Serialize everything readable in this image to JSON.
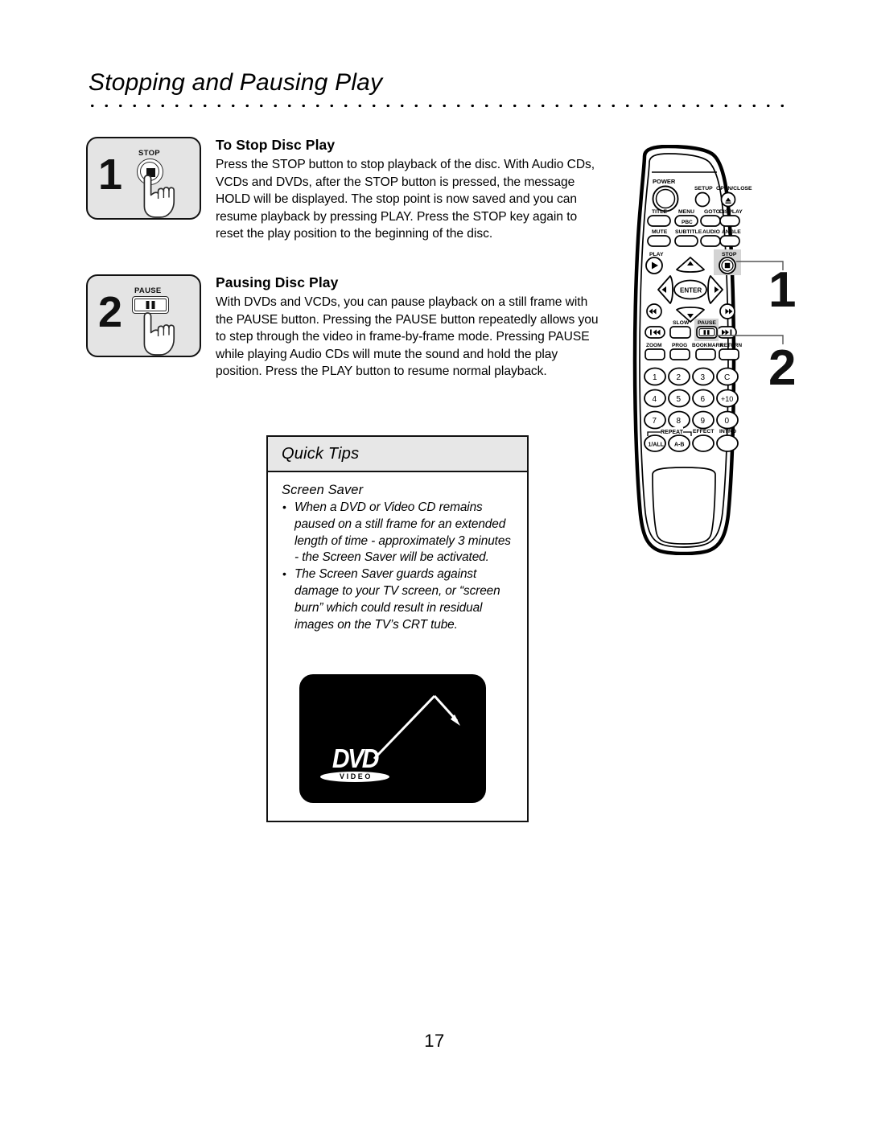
{
  "page": {
    "title": "Stopping and Pausing Play",
    "number": "17"
  },
  "sections": [
    {
      "step": "1",
      "button_label": "STOP",
      "heading": "To Stop Disc Play",
      "body": "Press the STOP button to stop playback of the disc. With Audio CDs, VCDs and DVDs, after the STOP button is pressed, the message HOLD will be displayed. The stop point is now saved and you can resume playback by pressing PLAY. Press the STOP key again to reset the play position to the beginning of the disc."
    },
    {
      "step": "2",
      "button_label": "PAUSE",
      "heading": "Pausing Disc Play",
      "body": "With DVDs and VCDs, you can pause playback on a still frame with the PAUSE button. Pressing the PAUSE button repeatedly allows you to step through the video in frame-by-frame mode. Pressing PAUSE while playing Audio CDs will mute the sound and hold the play position. Press the PLAY button to resume normal playback."
    }
  ],
  "quick_tips": {
    "header": "Quick Tips",
    "subtitle": "Screen Saver",
    "bullets": [
      "When a DVD or Video CD remains paused on a still frame for an extended length of time - approximately 3 minutes - the Screen Saver will be activated.",
      "The Screen Saver guards against damage to your TV screen, or “screen burn” which could result in residual images on the TV’s CRT tube."
    ],
    "screensaver_image": {
      "logo_top": "DVD",
      "logo_bottom": "VIDEO"
    }
  },
  "callouts": [
    {
      "number": "1",
      "points_to": "STOP"
    },
    {
      "number": "2",
      "points_to": "PAUSE"
    }
  ],
  "remote": {
    "power": "POWER",
    "row_setup": [
      "SETUP",
      "OPEN/CLOSE"
    ],
    "row_title": [
      "TITLE",
      "MENU",
      "PBC",
      "GOTO",
      "DISPLAY"
    ],
    "row_mute": [
      "MUTE",
      "SUBTITLE",
      "AUDIO",
      "ANGLE"
    ],
    "play": "PLAY",
    "stop": "STOP",
    "enter": "ENTER",
    "slow": "SLOW",
    "pause": "PAUSE",
    "row_zoom": [
      "ZOOM",
      "PROG",
      "BOOKMARK",
      "RETURN"
    ],
    "keypad": [
      [
        "1",
        "2",
        "3",
        "C"
      ],
      [
        "4",
        "5",
        "6",
        "+10"
      ],
      [
        "7",
        "8",
        "9",
        "0"
      ]
    ],
    "repeat_label": "REPEAT",
    "bottom_row": [
      "1/ALL",
      "A-B",
      "EFFECT",
      "INTRO"
    ]
  },
  "colors": {
    "highlight": "#d3d3d3",
    "step_box_fill": "#e4e4e4",
    "tips_header_fill": "#e7e7e7",
    "ink": "#111111"
  }
}
